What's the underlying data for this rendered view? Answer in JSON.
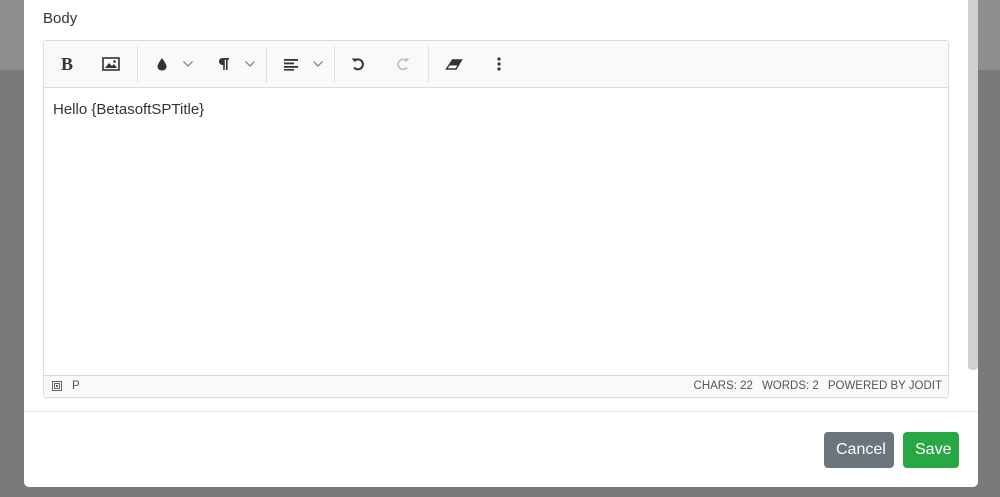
{
  "field": {
    "label": "Body"
  },
  "editor": {
    "content": "Hello {BetasoftSPTitle}",
    "status": {
      "path_tag": "P",
      "chars": "CHARS: 22",
      "words": "WORDS: 2",
      "powered": "POWERED BY JODIT"
    }
  },
  "footer": {
    "cancel_label": "Cancel",
    "save_label": "Save"
  },
  "colors": {
    "cancel": "#6c757d",
    "save": "#28a745",
    "toolbar_bg": "#f9f9f9"
  },
  "icons": [
    "bold-icon",
    "image-icon",
    "brush-icon",
    "paragraph-icon",
    "align-icon",
    "undo-icon",
    "redo-icon",
    "eraser-icon",
    "more-icon",
    "source-icon"
  ]
}
